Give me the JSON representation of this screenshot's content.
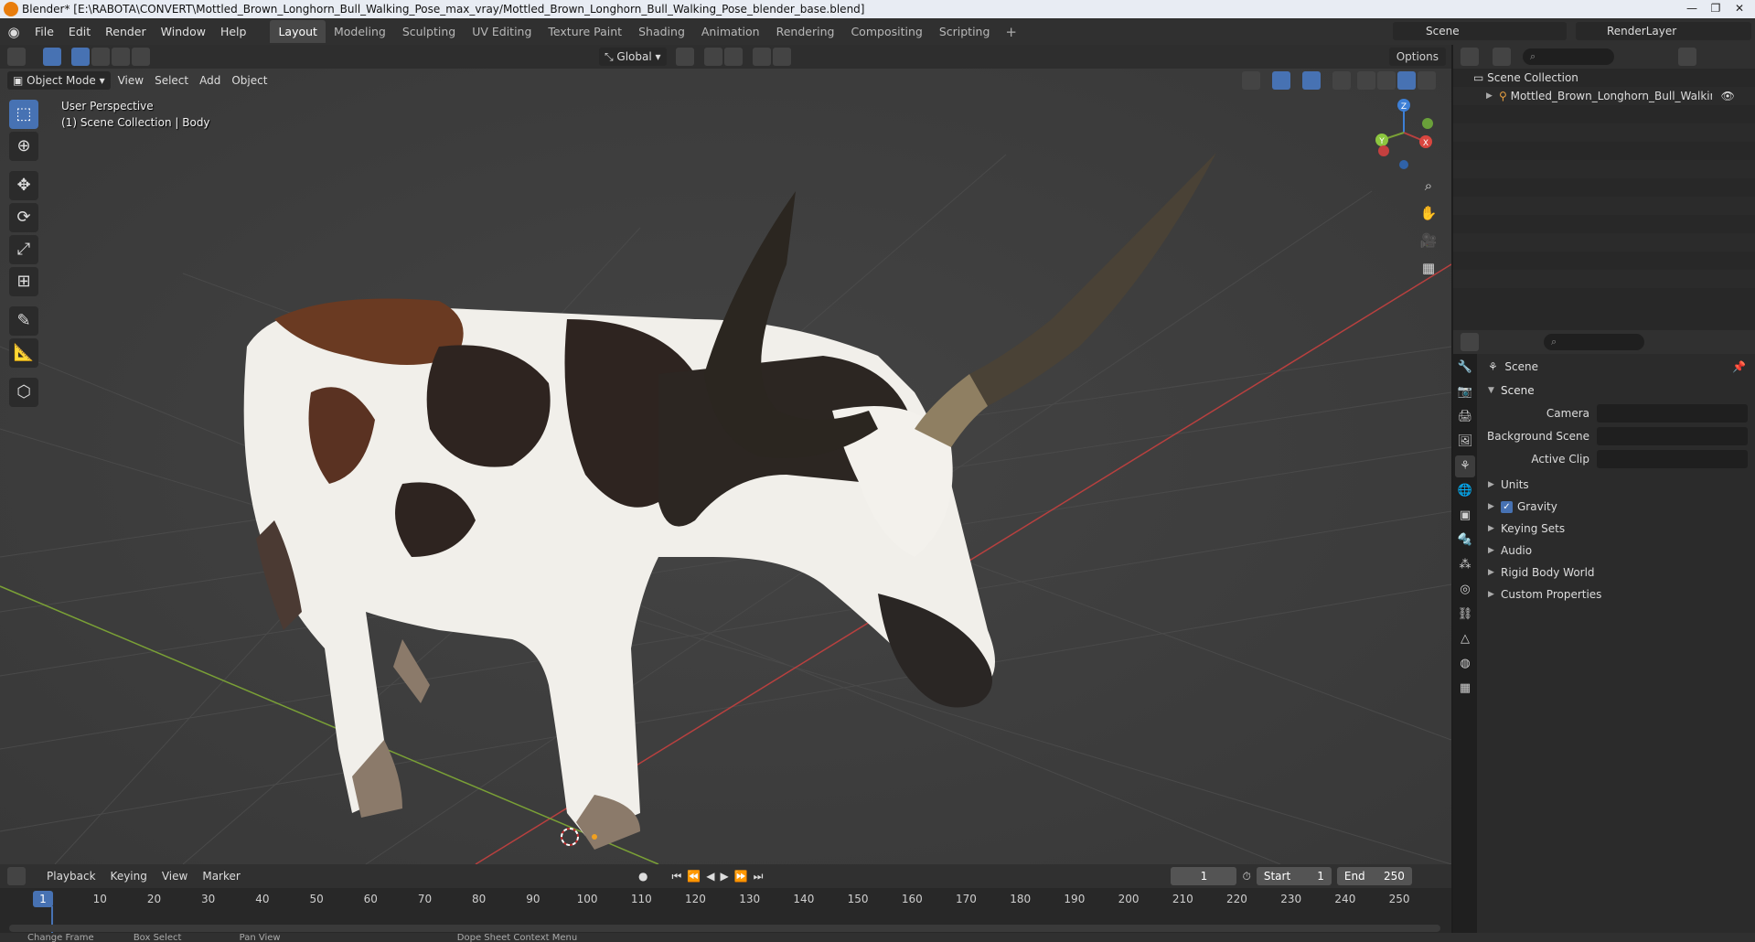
{
  "window": {
    "title": "Blender* [E:\\RABOTA\\CONVERT\\Mottled_Brown_Longhorn_Bull_Walking_Pose_max_vray/Mottled_Brown_Longhorn_Bull_Walking_Pose_blender_base.blend]",
    "controls": [
      "—",
      "❐",
      "✕"
    ]
  },
  "menu": [
    "File",
    "Edit",
    "Render",
    "Window",
    "Help"
  ],
  "workspaces": [
    {
      "label": "Layout",
      "active": true
    },
    {
      "label": "Modeling"
    },
    {
      "label": "Sculpting"
    },
    {
      "label": "UV Editing"
    },
    {
      "label": "Texture Paint"
    },
    {
      "label": "Shading"
    },
    {
      "label": "Animation"
    },
    {
      "label": "Rendering"
    },
    {
      "label": "Compositing"
    },
    {
      "label": "Scripting"
    }
  ],
  "scene_selector": "Scene",
  "layer_selector": "RenderLayer",
  "viewport": {
    "transform_orientation": "Global",
    "options_label": "Options",
    "mode": "Object Mode",
    "header_menus": [
      "View",
      "Select",
      "Add",
      "Object"
    ],
    "overlay_line1": "User Perspective",
    "overlay_line2": "(1) Scene Collection | Body",
    "gizmo_axes": {
      "x": "X",
      "y": "Y",
      "z": "Z"
    },
    "colors": {
      "background": "#3d3d3d",
      "x_axis": "#b8403f",
      "y_axis": "#7aa036",
      "z_axis": "#3d7fd6",
      "selection": "#4772b3"
    }
  },
  "tools": [
    "select-box",
    "cursor",
    "move",
    "rotate",
    "scale",
    "transform",
    "annotate",
    "measure",
    "add-cube"
  ],
  "timeline": {
    "menus": [
      "Playback",
      "Keying",
      "View",
      "Marker"
    ],
    "current_frame": "1",
    "start_label": "Start",
    "start": "1",
    "end_label": "End",
    "end": "250",
    "playhead": "1",
    "ticks": [
      "10",
      "20",
      "30",
      "40",
      "50",
      "60",
      "70",
      "80",
      "90",
      "100",
      "110",
      "120",
      "130",
      "140",
      "150",
      "160",
      "170",
      "180",
      "190",
      "200",
      "210",
      "220",
      "230",
      "240",
      "250"
    ]
  },
  "statusbar": [
    "Change Frame",
    "Box Select",
    "Pan View",
    "Dope Sheet Context Menu"
  ],
  "outliner": {
    "root": "Scene Collection",
    "items": [
      {
        "label": "Mottled_Brown_Longhorn_Bull_Walking_Pos"
      }
    ]
  },
  "properties": {
    "context": "Scene",
    "panel": "Scene",
    "fields": [
      {
        "label": "Camera"
      },
      {
        "label": "Background Scene"
      },
      {
        "label": "Active Clip"
      }
    ],
    "subpanels": [
      "Units",
      "Gravity",
      "Keying Sets",
      "Audio",
      "Rigid Body World",
      "Custom Properties"
    ],
    "gravity_checked": true
  }
}
